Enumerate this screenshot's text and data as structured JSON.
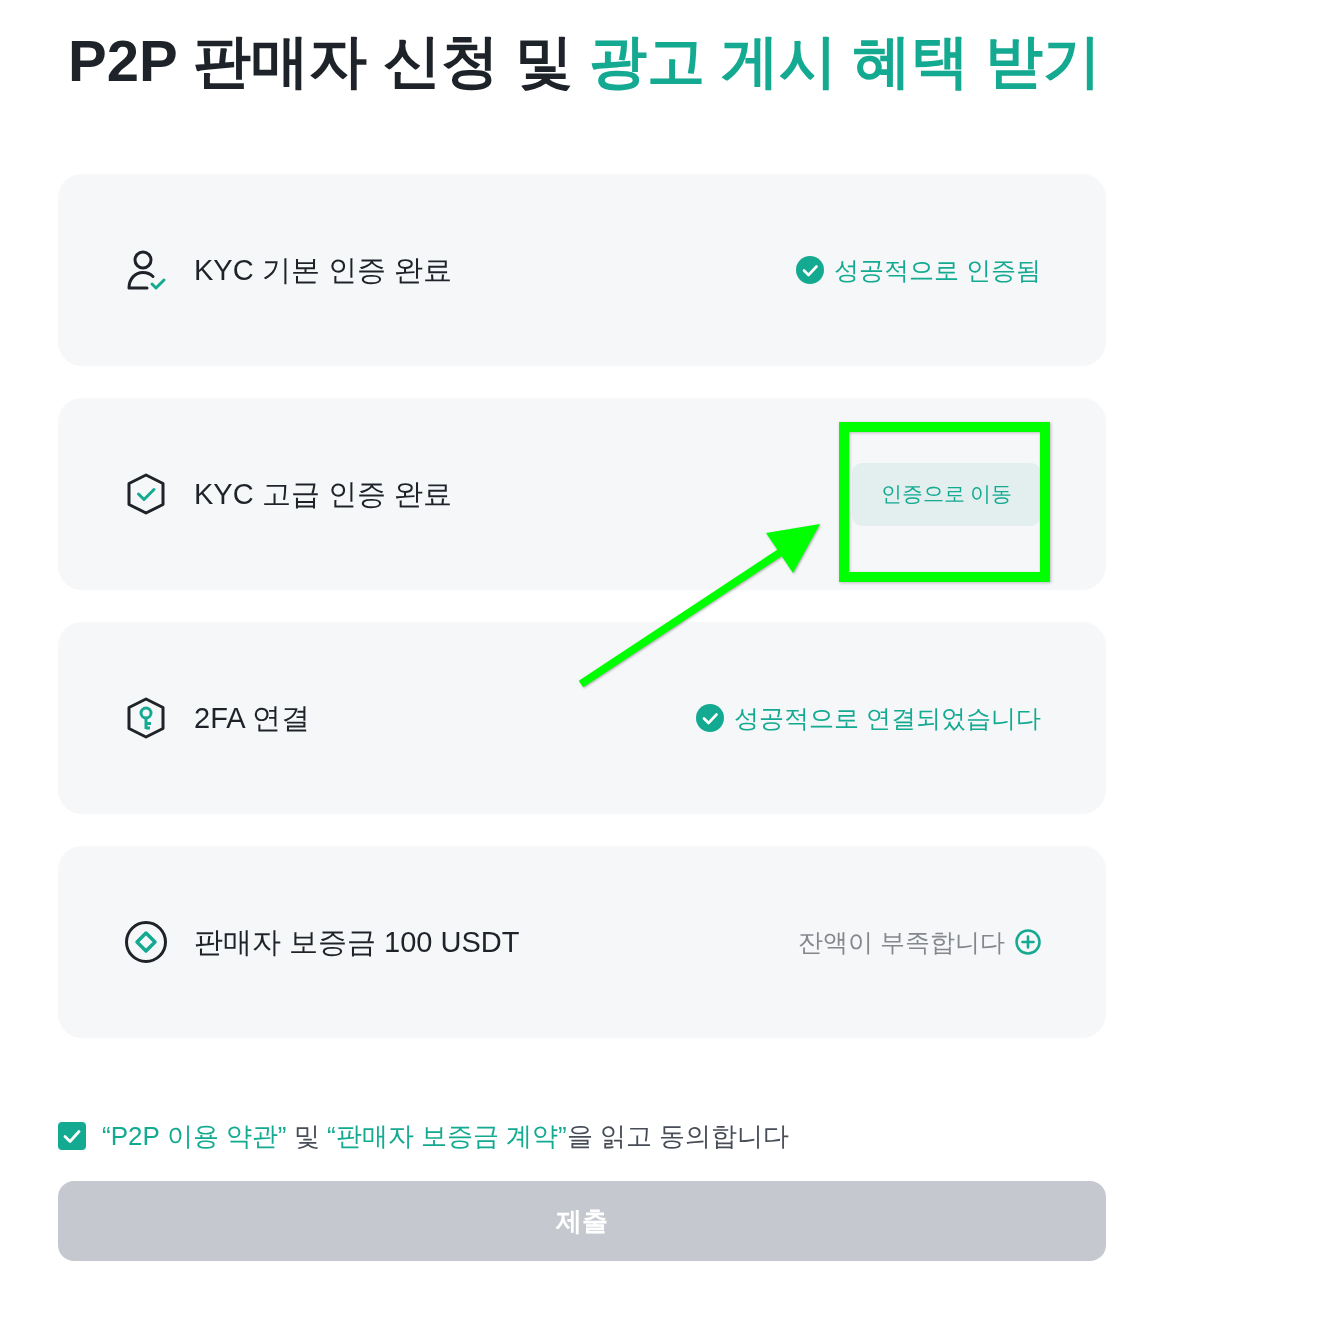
{
  "heading": {
    "text": "P2P 판매자 신청 및",
    "highlight": "광고 게시 혜택 받기"
  },
  "requirements": [
    {
      "label": "KYC 기본 인증 완료",
      "kind": "verified",
      "status": "성공적으로 인증됨",
      "highlighted": false
    },
    {
      "label": "KYC 고급 인증 완료",
      "kind": "action",
      "status": "인증으로 이동",
      "highlighted": true
    },
    {
      "label": "2FA 연결",
      "kind": "verified",
      "status": "성공적으로 연결되었습니다",
      "highlighted": false
    },
    {
      "label": "판매자 보증금 100 USDT",
      "kind": "insufficient",
      "status": "잔액이 부족합니다",
      "highlighted": false
    }
  ],
  "agreement": {
    "checked": true,
    "parts": [
      {
        "kind": "link",
        "text": "“P2P 이용 약관”"
      },
      {
        "kind": "text",
        "text": " 및 "
      },
      {
        "kind": "link",
        "text": "“판매자 보증금 계약”"
      },
      {
        "kind": "text",
        "text": "을 읽고 동의합니다"
      }
    ]
  },
  "submit_button": {
    "label": "제출",
    "disabled": true
  }
}
